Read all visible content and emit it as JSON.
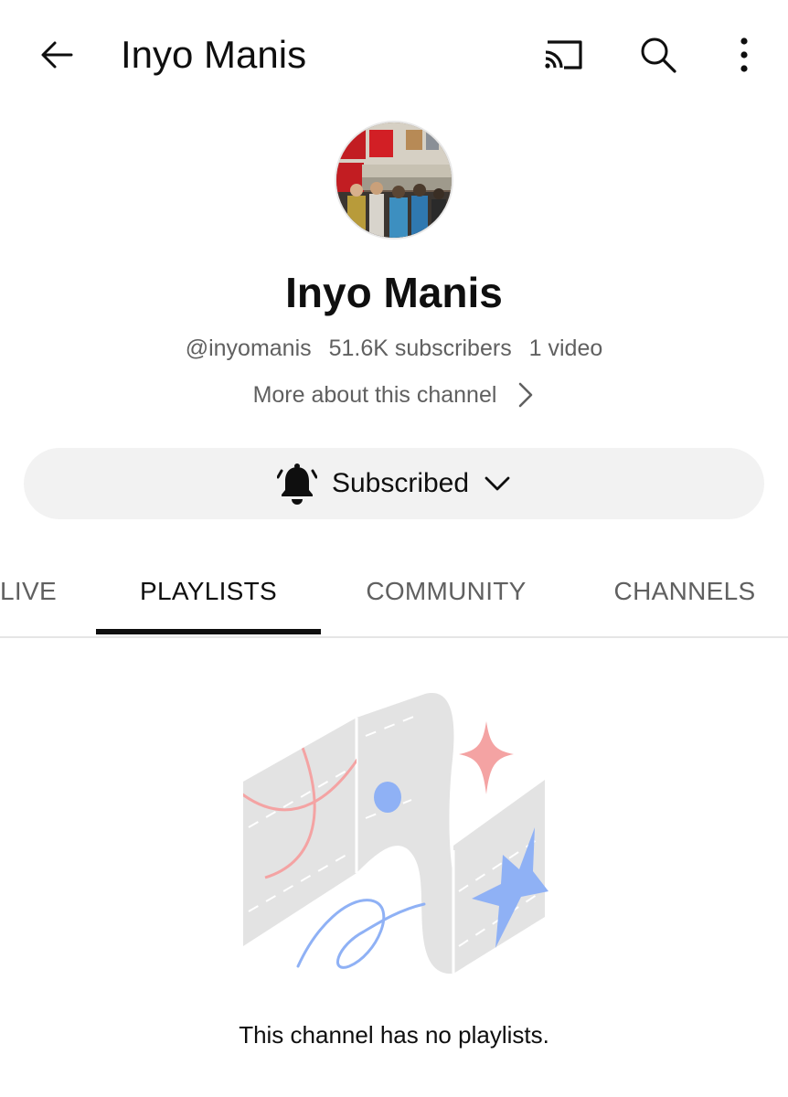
{
  "header": {
    "title": "Inyo Manis",
    "icons": [
      "back-arrow-icon",
      "cast-icon",
      "search-icon",
      "more-vert-icon"
    ]
  },
  "channel": {
    "name": "Inyo Manis",
    "handle": "@inyomanis",
    "subscribers": "51.6K subscribers",
    "videos": "1 video",
    "more_about": "More about this channel",
    "subscribe_label": "Subscribed"
  },
  "tabs": [
    {
      "label": "LIVE",
      "active": false
    },
    {
      "label": "PLAYLISTS",
      "active": true
    },
    {
      "label": "COMMUNITY",
      "active": false
    },
    {
      "label": "CHANNELS",
      "active": false
    }
  ],
  "empty_state": {
    "message": "This channel has no playlists."
  },
  "colors": {
    "text_primary": "#0f0f0f",
    "text_secondary": "#606060",
    "button_bg": "#f2f2f2",
    "illustration_gray": "#e3e3e3",
    "illustration_red": "#f4a3a3",
    "illustration_blue": "#8fb1f5"
  }
}
